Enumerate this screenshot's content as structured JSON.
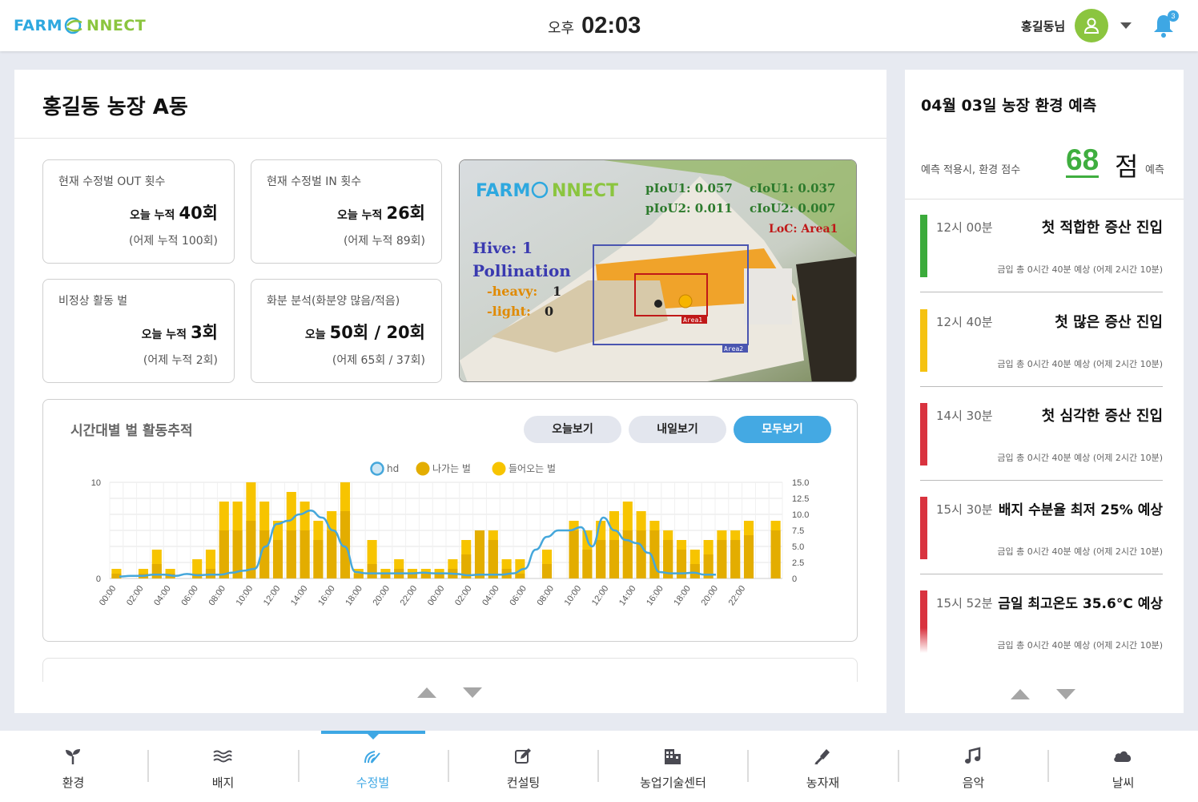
{
  "header": {
    "logo_left": "FARM",
    "logo_mid": "C",
    "logo_right": "NNECT",
    "ampm": "오후",
    "time": "02:03",
    "user_name": "홍길동님",
    "notification_count": "3"
  },
  "main": {
    "title": "홍길동 농장 A동",
    "cards": [
      {
        "label": "현재 수정벌 OUT 횟수",
        "today_prefix": "오늘 누적",
        "today_value": "40회",
        "yesterday": "(어제 누적 100회)"
      },
      {
        "label": "현재 수정벌 IN 횟수",
        "today_prefix": "오늘 누적",
        "today_value": "26회",
        "yesterday": "(어제 누적 89회)"
      },
      {
        "label": "비정상 활동 벌",
        "today_prefix": "오늘 누적",
        "today_value": "3회",
        "yesterday": "(어제 누적 2회)"
      },
      {
        "label": "화분 분석(화분양 많음/적음)",
        "today_prefix": "오늘",
        "today_value": "50회 / 20회",
        "yesterday": "(어제 65회 / 37회)"
      }
    ],
    "camera": {
      "logo_left": "FARM",
      "logo_right": "NNECT",
      "piou1": "pIoU1: 0.057",
      "ciou1": "cIoU1: 0.037",
      "piou2": "pIoU2: 0.011",
      "ciou2": "cIoU2: 0.007",
      "loc": "LoC: Area1",
      "hive": "Hive:  1",
      "pollination": "Pollination",
      "heavy": "-heavy:",
      "heavy_val": "1",
      "light": "-light:",
      "light_val": "0",
      "area1": "Area1",
      "area2": "Area2"
    },
    "chart_panel": {
      "title": "시간대별 벌 활동추적",
      "buttons": [
        "오늘보기",
        "내일보기",
        "모두보기"
      ],
      "active_button": "모두보기"
    }
  },
  "side": {
    "title": "04월 03일 농장 환경 예측",
    "score_label": "예측 적용시, 환경 점수",
    "score_value": "68",
    "score_unit": "점",
    "score_suffix": "예측",
    "forecasts": [
      {
        "time": "12시 00분",
        "text": "첫 적합한 증산 진입",
        "sub": "금입 총 0시간 40분 예상 (어제 2시간 10분)",
        "color": "#3bab3b"
      },
      {
        "time": "12시 40분",
        "text": "첫 많은 증산 진입",
        "sub": "금입 총 0시간 40분 예상 (어제 2시간 10분)",
        "color": "#f5c211"
      },
      {
        "time": "14시 30분",
        "text": "첫 심각한 증산 진입",
        "sub": "금입 총 0시간 40분 예상 (어제 2시간 10분)",
        "color": "#d9333f"
      },
      {
        "time": "15시 30분",
        "text": "배지 수분율 최저 25% 예상",
        "sub": "금입 총 0시간 40분 예상 (어제 2시간 10분)",
        "color": "#d9333f"
      },
      {
        "time": "15시 52분",
        "text": "금일 최고온도 35.6°C 예상",
        "sub": "금입 총 0시간 40분 예상 (어제 2시간 10분)",
        "color": "#d9333f"
      }
    ]
  },
  "nav": {
    "items": [
      "환경",
      "배지",
      "수정벌",
      "컨설팅",
      "농업기술센터",
      "농자재",
      "음악",
      "날씨"
    ],
    "icons": [
      "sprout-icon",
      "waves-icon",
      "bee-signal-icon",
      "edit-icon",
      "building-icon",
      "tool-icon",
      "music-icon",
      "cloud-icon"
    ],
    "active": "수정벌"
  },
  "chart_data": {
    "type": "bar",
    "legend": [
      "hd",
      "나가는 벌",
      "들어오는 벌"
    ],
    "legend_position": "top",
    "colors": {
      "hd": "#45a7db",
      "out": "#e3ad00",
      "in": "#f7c400"
    },
    "x_tick_labels": [
      "00:00",
      "02:00",
      "04:00",
      "06:00",
      "08:00",
      "10:00",
      "12:00",
      "14:00",
      "16:00",
      "18:00",
      "20:00",
      "22:00",
      "00:00",
      "02:00",
      "04:00",
      "06:00",
      "08:00",
      "10:00",
      "12:00",
      "14:00",
      "16:00",
      "18:00",
      "20:00",
      "22:00"
    ],
    "y_left": {
      "ticks": [
        "10",
        "0"
      ],
      "range": [
        0,
        10
      ]
    },
    "y_right": {
      "ticks": [
        "15.0",
        "12.5",
        "10.0",
        "7.5",
        "5.0",
        "2.5",
        "0"
      ],
      "range": [
        0,
        15
      ]
    },
    "series": [
      {
        "name": "나가는 벌",
        "axis": "left",
        "values": [
          0.5,
          0,
          0.5,
          1.5,
          0.5,
          0,
          0.5,
          1,
          5,
          5,
          6,
          5,
          4,
          5,
          5,
          4,
          5,
          7,
          0.5,
          1.5,
          0.5,
          1,
          0.5,
          0.5,
          0.5,
          1,
          2.5,
          5,
          4,
          1,
          0.5,
          0,
          1.5,
          0,
          5,
          3,
          4,
          4,
          5,
          5,
          5,
          4,
          3,
          1.5,
          2.5,
          4,
          4,
          4.5,
          0,
          5
        ]
      },
      {
        "name": "들어오는 벌",
        "axis": "left",
        "values": [
          1,
          0,
          1,
          3,
          1,
          0,
          2,
          3,
          8,
          8,
          10,
          8,
          6,
          9,
          8,
          6,
          7,
          10,
          1,
          4,
          1,
          2,
          1,
          1,
          1,
          2,
          4,
          5,
          5,
          2,
          2,
          0,
          3,
          0,
          6,
          5,
          6,
          7,
          8,
          7,
          6,
          5,
          4,
          3,
          4,
          5,
          5,
          6,
          0,
          6
        ]
      },
      {
        "name": "hd",
        "axis": "right",
        "values": [
          0.3,
          0.4,
          0.4,
          0.6,
          0.6,
          0.4,
          0.7,
          0.5,
          0.6,
          0.6,
          0.9,
          1.2,
          1.5,
          5,
          8.5,
          9,
          10,
          10.6,
          9.5,
          7.5,
          5,
          1,
          0.8,
          0.8,
          0.8,
          0.8,
          0.8,
          0.9,
          0.8,
          0.8,
          0.7,
          0.5,
          0.6,
          0.6,
          0.6,
          0.8,
          1.5,
          4.5,
          6.5,
          7.5,
          7.5,
          8,
          5,
          9.5,
          7.5,
          6,
          5.5,
          4,
          1,
          0.8,
          0.8,
          0.9,
          0.6,
          0.6
        ]
      }
    ]
  }
}
